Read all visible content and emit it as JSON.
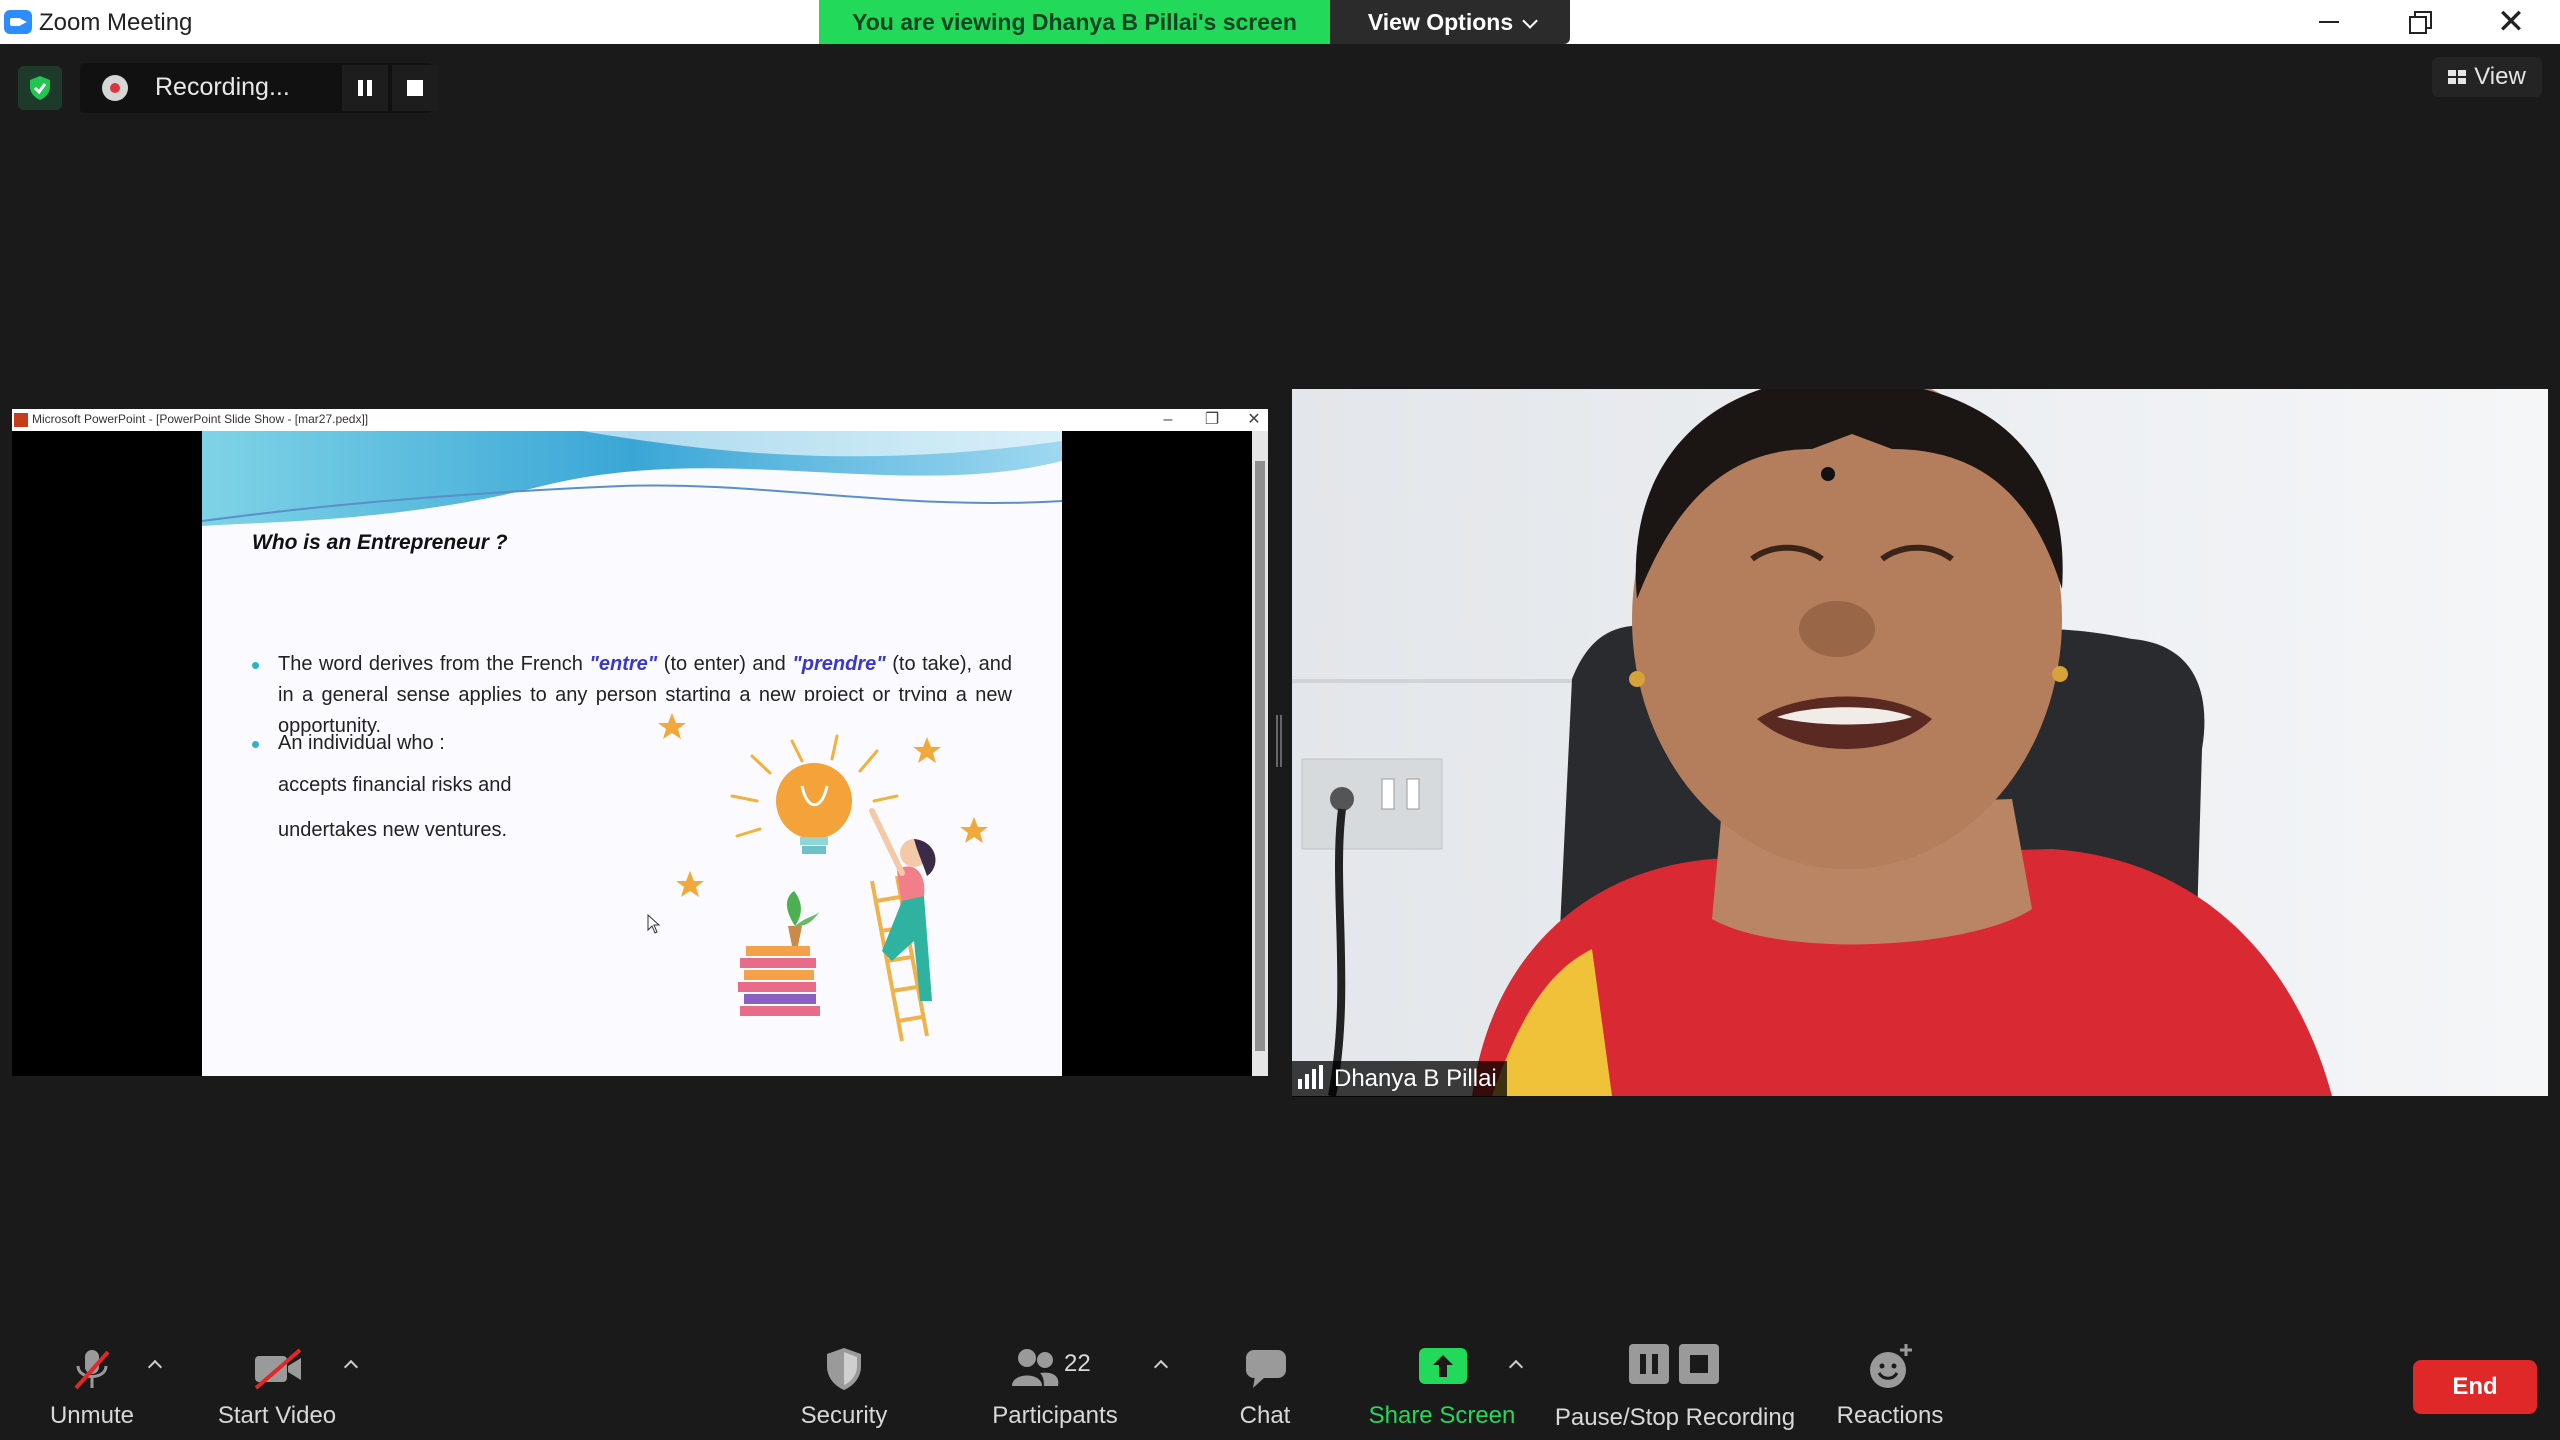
{
  "window": {
    "title": "Zoom Meeting",
    "viewing_banner": "You are viewing Dhanya B Pillai's screen",
    "view_options": "View Options"
  },
  "recording": {
    "status": "Recording..."
  },
  "view_button": "View",
  "shared_screen": {
    "window_title": "Microsoft PowerPoint - [PowerPoint Slide Show - [mar27.pedx]]",
    "slide": {
      "title": "Who is an Entrepreneur ?",
      "bullet1_pre": "The word derives from the French ",
      "bullet1_em1": "\"entre\"",
      "bullet1_mid": " (to enter) and ",
      "bullet1_em2": "\"prendre\"",
      "bullet1_post": " (to take), and in a general sense applies to any person starting a new project or trying a new opportunity.",
      "bullet2": "An individual who :",
      "sub1": "accepts financial risks and",
      "sub2": "undertakes new ventures."
    }
  },
  "participant": {
    "name": "Dhanya B Pillai"
  },
  "toolbar": {
    "unmute": "Unmute",
    "start_video": "Start Video",
    "security": "Security",
    "participants": "Participants",
    "participants_count": "22",
    "chat": "Chat",
    "share_screen": "Share Screen",
    "pause_stop_recording": "Pause/Stop Recording",
    "reactions": "Reactions",
    "end": "End"
  },
  "colors": {
    "banner_green": "#23d959",
    "share_green": "#23d959",
    "end_red": "#e02828",
    "zoom_blue": "#2d8cff"
  }
}
